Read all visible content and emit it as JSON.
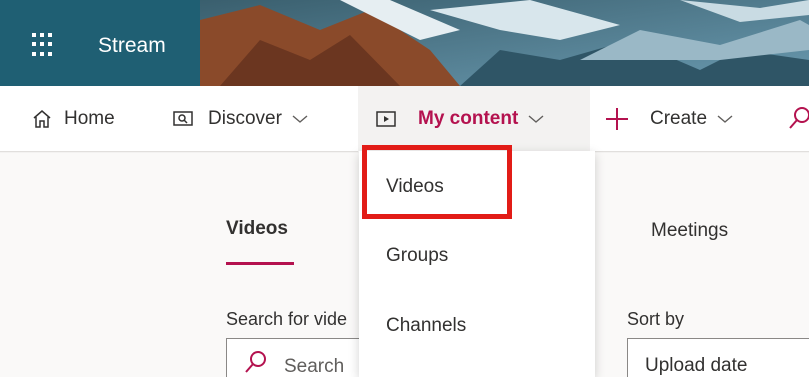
{
  "app": {
    "name": "Stream"
  },
  "nav": {
    "home": "Home",
    "discover": "Discover",
    "my_content": "My content",
    "create": "Create"
  },
  "tabs": {
    "videos": "Videos",
    "meetings": "Meetings"
  },
  "filters": {
    "search_label": "Search for vide",
    "search_placeholder": "Search",
    "sort_label": "Sort by",
    "sort_value": "Upload date"
  },
  "dropdown": {
    "items": [
      "Videos",
      "Groups",
      "Channels"
    ],
    "highlighted_item": "Videos",
    "highlight_color": "#e21c17"
  },
  "colors": {
    "brand": "#1f5f73",
    "accent": "#b4124f"
  },
  "icons": [
    "waffle-icon",
    "home-icon",
    "discover-icon",
    "my-content-icon",
    "plus-icon",
    "search-icon",
    "chevron-down-icon"
  ]
}
